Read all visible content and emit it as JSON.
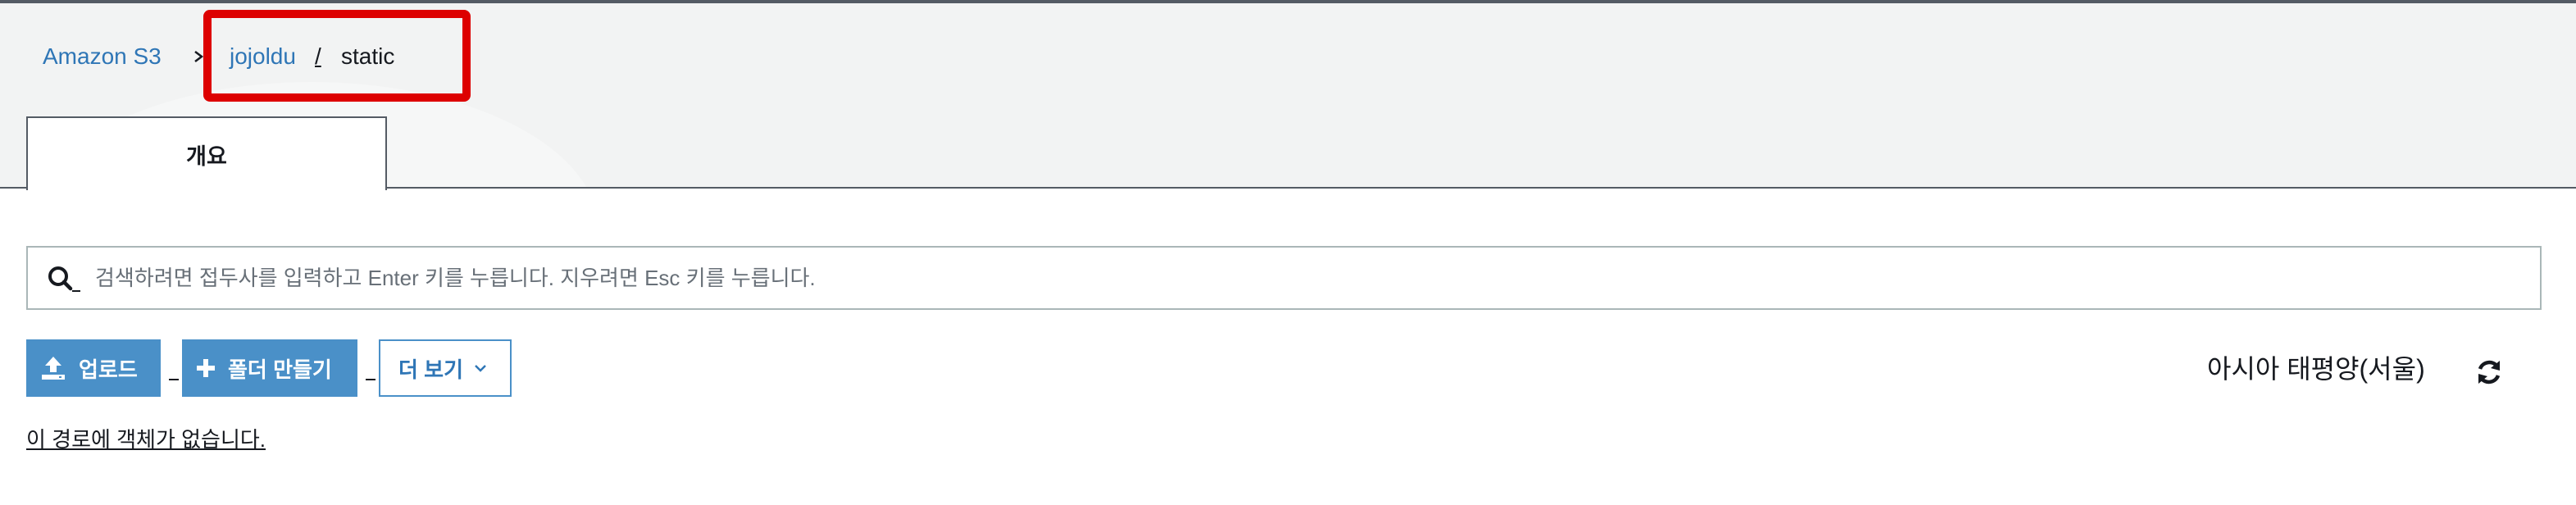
{
  "breadcrumb": {
    "root": "Amazon S3",
    "bucket": "jojoldu",
    "separator": "/",
    "current": "static"
  },
  "tabs": [
    {
      "label": "개요",
      "selected": true
    }
  ],
  "search": {
    "value": "",
    "placeholder": "검색하려면 접두사를 입력하고 Enter 키를 누릅니다. 지우려면 Esc 키를 누릅니다."
  },
  "toolbar": {
    "upload_label": "업로드",
    "create_folder_label": "폴더 만들기",
    "more_label": "더 보기",
    "region_label": "아시아 태평양(서울)"
  },
  "icons": {
    "search": "search-icon",
    "upload": "upload-icon",
    "add": "plus-icon",
    "more": "chevron-down-icon",
    "refresh": "refresh-icon",
    "breadcrumb_separator": "chevron-right-icon"
  },
  "empty_message": "이 경로에 객체가 없습니다.",
  "colors": {
    "link": "#2f76b6",
    "primary_button": "#4a90c8",
    "highlight": "#dd0000",
    "band_background": "#f2f3f3"
  }
}
